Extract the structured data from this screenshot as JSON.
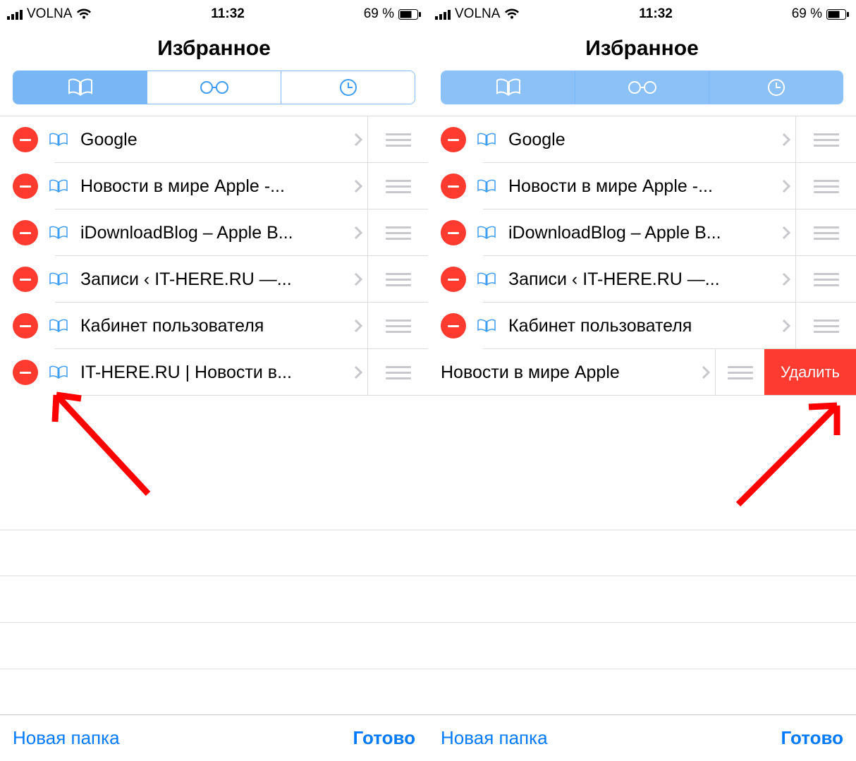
{
  "status": {
    "carrier": "VOLNA",
    "time": "11:32",
    "battery_text": "69 %"
  },
  "header": {
    "title": "Избранное"
  },
  "tabs": [
    "bookmarks",
    "reading-list",
    "history"
  ],
  "left_screen": {
    "items": [
      {
        "label": "Google"
      },
      {
        "label": "Новости в мире Apple -..."
      },
      {
        "label": "iDownloadBlog – Apple B..."
      },
      {
        "label": "Записи ‹ IT-HERE.RU —..."
      },
      {
        "label": "Кабинет пользователя"
      },
      {
        "label": "IT-HERE.RU | Новости в..."
      }
    ]
  },
  "right_screen": {
    "items": [
      {
        "label": "Google"
      },
      {
        "label": "Новости в мире Apple -..."
      },
      {
        "label": "iDownloadBlog – Apple B..."
      },
      {
        "label": "Записи ‹ IT-HERE.RU —..."
      },
      {
        "label": "Кабинет пользователя"
      }
    ],
    "swiped": {
      "label": "Новости в мире Apple",
      "delete_label": "Удалить"
    }
  },
  "toolbar": {
    "new_folder": "Новая папка",
    "done": "Готово"
  }
}
